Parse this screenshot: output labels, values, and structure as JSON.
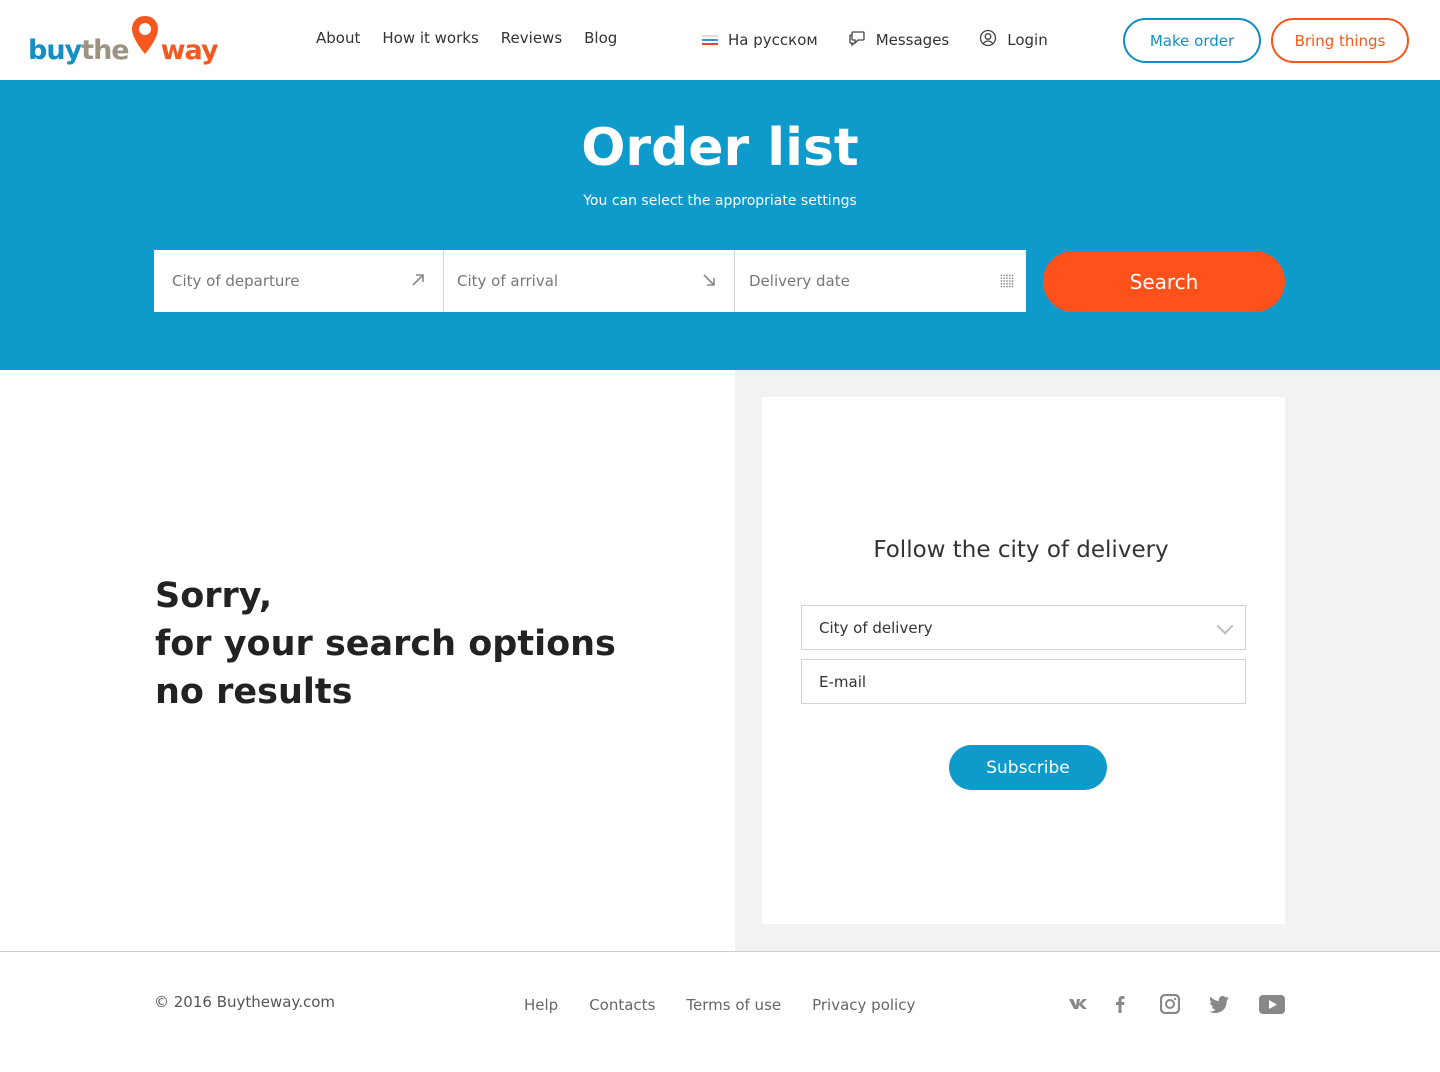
{
  "brand": {
    "logo_parts": [
      "buy",
      "the",
      "way"
    ],
    "colors": {
      "blue": "#138fc4",
      "taupe": "#9c9381",
      "orange": "#f4581f",
      "hero": "#0e9acb",
      "search": "#ff5119"
    }
  },
  "nav": {
    "items": [
      "About",
      "How it works",
      "Reviews",
      "Blog"
    ]
  },
  "utility": {
    "language": "На русском",
    "messages": "Messages",
    "login": "Login"
  },
  "header_buttons": {
    "make_order": "Make order",
    "bring_things": "Bring things"
  },
  "hero": {
    "title": "Order list",
    "subtitle": "You can select the appropriate settings",
    "search": {
      "departure_placeholder": "City of departure",
      "arrival_placeholder": "City of arrival",
      "date_placeholder": "Delivery date",
      "button": "Search"
    }
  },
  "results": {
    "line1": "Sorry,",
    "line2": "for your search options",
    "line3": "no results"
  },
  "subscribe": {
    "title": "Follow the city of delivery",
    "city_select": "City of delivery",
    "email_placeholder": "E-mail",
    "button": "Subscribe"
  },
  "footer": {
    "copyright": "© 2016 Buytheway.com",
    "links": [
      "Help",
      "Contacts",
      "Terms of use",
      "Privacy policy"
    ],
    "social": [
      "vk-icon",
      "facebook-icon",
      "instagram-icon",
      "twitter-icon",
      "youtube-icon"
    ]
  }
}
